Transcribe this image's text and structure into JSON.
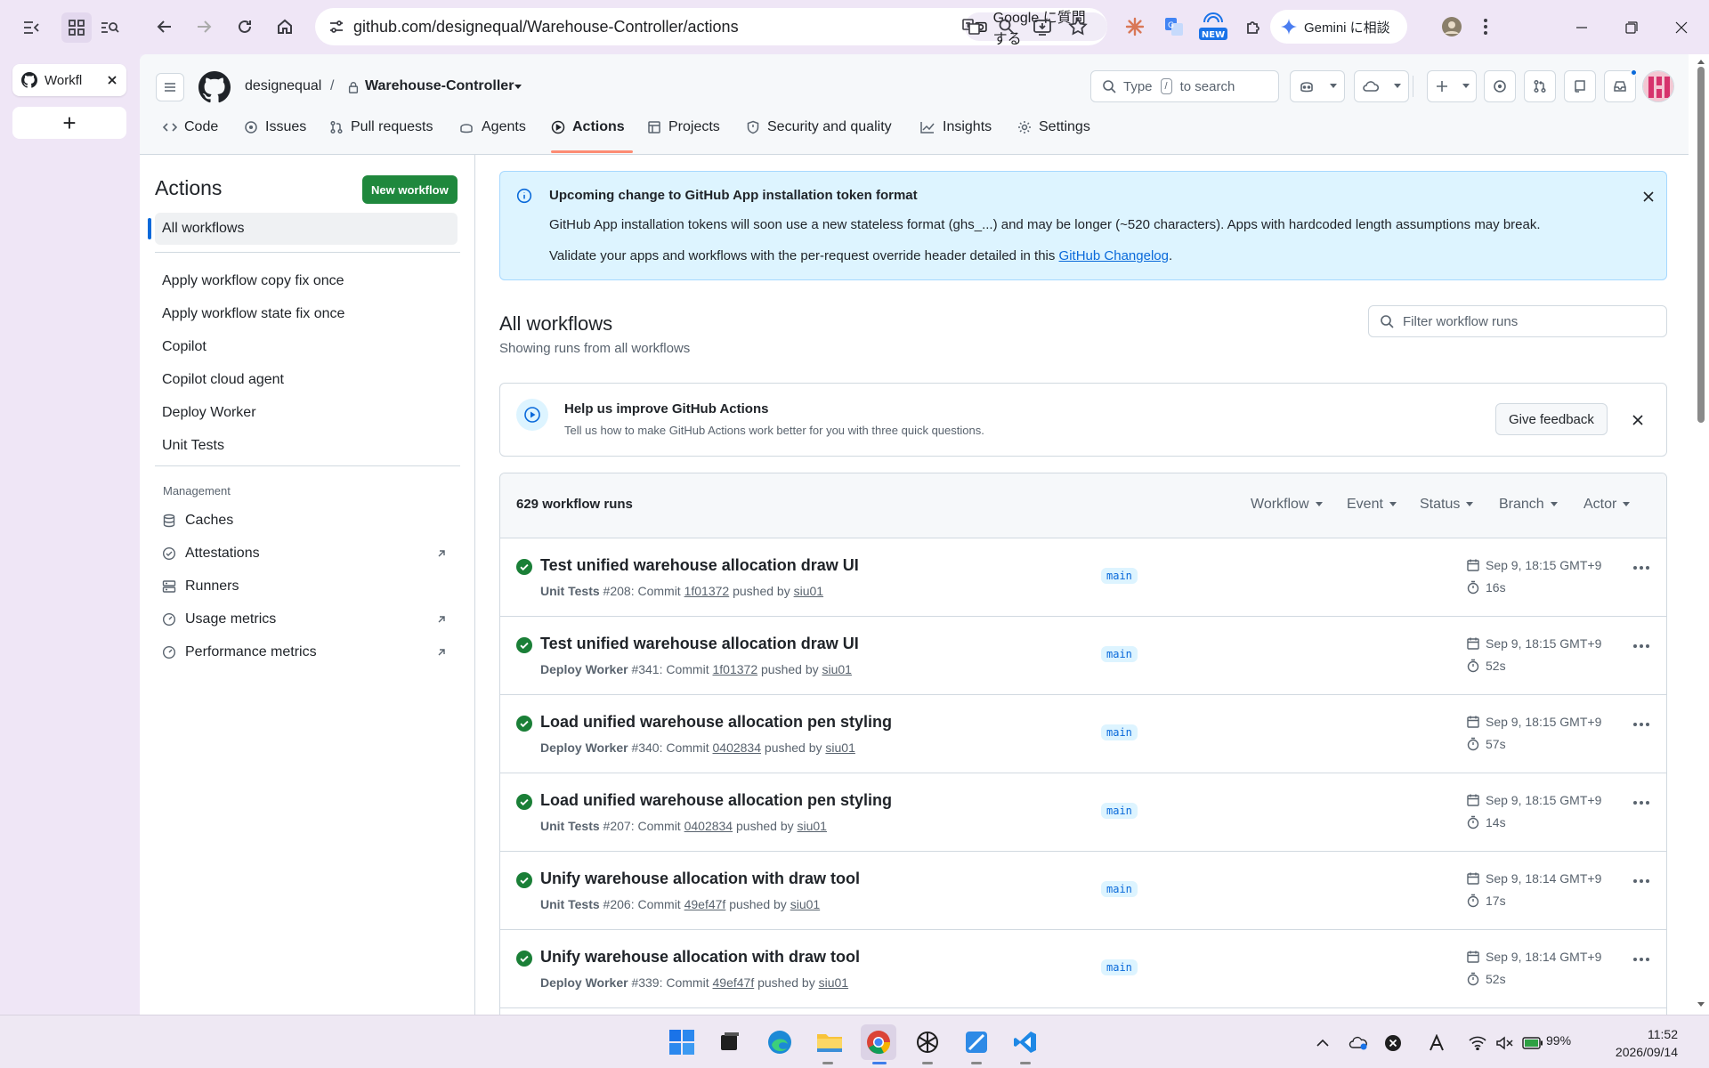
{
  "browser": {
    "tab_title": "Workfl",
    "url": "github.com/designequal/Warehouse-Controller/actions",
    "ask_google": "Google に質問する",
    "gemini_label": "Gemini に相談",
    "new_badge": "NEW"
  },
  "github": {
    "owner": "designequal",
    "repo": "Warehouse-Controller",
    "search_placeholder": {
      "pre": "Type",
      "key": "/",
      "post": "to search"
    },
    "tabs": [
      {
        "label": "Code",
        "icon": "code-icon"
      },
      {
        "label": "Issues",
        "icon": "issue-icon"
      },
      {
        "label": "Pull requests",
        "icon": "pull-request-icon"
      },
      {
        "label": "Agents",
        "icon": "agents-icon"
      },
      {
        "label": "Actions",
        "icon": "play-icon",
        "active": true
      },
      {
        "label": "Projects",
        "icon": "table-icon"
      },
      {
        "label": "Security and quality",
        "icon": "shield-icon"
      },
      {
        "label": "Insights",
        "icon": "graph-icon"
      },
      {
        "label": "Settings",
        "icon": "gear-icon"
      }
    ]
  },
  "sidebar": {
    "title": "Actions",
    "new_workflow": "New workflow",
    "all_workflows": "All workflows",
    "workflows": [
      "Apply workflow copy fix once",
      "Apply workflow state fix once",
      "Copilot",
      "Copilot cloud agent",
      "Deploy Worker",
      "Unit Tests"
    ],
    "management_heading": "Management",
    "management": [
      {
        "label": "Caches",
        "icon": "database-icon",
        "external": false
      },
      {
        "label": "Attestations",
        "icon": "verified-icon",
        "external": true
      },
      {
        "label": "Runners",
        "icon": "server-icon",
        "external": false
      },
      {
        "label": "Usage metrics",
        "icon": "meter-icon",
        "external": true
      },
      {
        "label": "Performance metrics",
        "icon": "meter-icon",
        "external": true
      }
    ]
  },
  "banner": {
    "title": "Upcoming change to GitHub App installation token format",
    "line1": "GitHub App installation tokens will soon use a new stateless format (ghs_...) and may be longer (~520 characters). Apps with hardcoded length assumptions may break.",
    "line2_pre": "Validate your apps and workflows with the per-request override header detailed in this ",
    "line2_link": "GitHub Changelog",
    "line2_post": "."
  },
  "main": {
    "title": "All workflows",
    "subtitle": "Showing runs from all workflows",
    "filter_placeholder": "Filter workflow runs"
  },
  "feedback": {
    "title": "Help us improve GitHub Actions",
    "text": "Tell us how to make GitHub Actions work better for you with three quick questions.",
    "button": "Give feedback"
  },
  "runs": {
    "count_label": "629 workflow runs",
    "filters": [
      "Workflow",
      "Event",
      "Status",
      "Branch",
      "Actor"
    ],
    "items": [
      {
        "title": "Test unified warehouse allocation draw UI",
        "workflow": "Unit Tests",
        "number": "#208",
        "commit": "1f01372",
        "actor": "siu01",
        "branch": "main",
        "date": "Sep 9, 18:15 GMT+9",
        "duration": "16s"
      },
      {
        "title": "Test unified warehouse allocation draw UI",
        "workflow": "Deploy Worker",
        "number": "#341",
        "commit": "1f01372",
        "actor": "siu01",
        "branch": "main",
        "date": "Sep 9, 18:15 GMT+9",
        "duration": "52s"
      },
      {
        "title": "Load unified warehouse allocation pen styling",
        "workflow": "Deploy Worker",
        "number": "#340",
        "commit": "0402834",
        "actor": "siu01",
        "branch": "main",
        "date": "Sep 9, 18:15 GMT+9",
        "duration": "57s"
      },
      {
        "title": "Load unified warehouse allocation pen styling",
        "workflow": "Unit Tests",
        "number": "#207",
        "commit": "0402834",
        "actor": "siu01",
        "branch": "main",
        "date": "Sep 9, 18:15 GMT+9",
        "duration": "14s"
      },
      {
        "title": "Unify warehouse allocation with draw tool",
        "workflow": "Unit Tests",
        "number": "#206",
        "commit": "49ef47f",
        "actor": "siu01",
        "branch": "main",
        "date": "Sep 9, 18:14 GMT+9",
        "duration": "17s"
      },
      {
        "title": "Unify warehouse allocation with draw tool",
        "workflow": "Deploy Worker",
        "number": "#339",
        "commit": "49ef47f",
        "actor": "siu01",
        "branch": "main",
        "date": "Sep 9, 18:14 GMT+9",
        "duration": "52s"
      }
    ],
    "commit_word": "Commit",
    "pushed_by": "pushed by"
  },
  "taskbar": {
    "time": "11:52",
    "date": "2026/09/14",
    "battery": "99%"
  },
  "colors": {
    "accent": "#1f883d",
    "link": "#0969da",
    "success": "#1a7f37",
    "tab_underline": "#fd8c73"
  }
}
